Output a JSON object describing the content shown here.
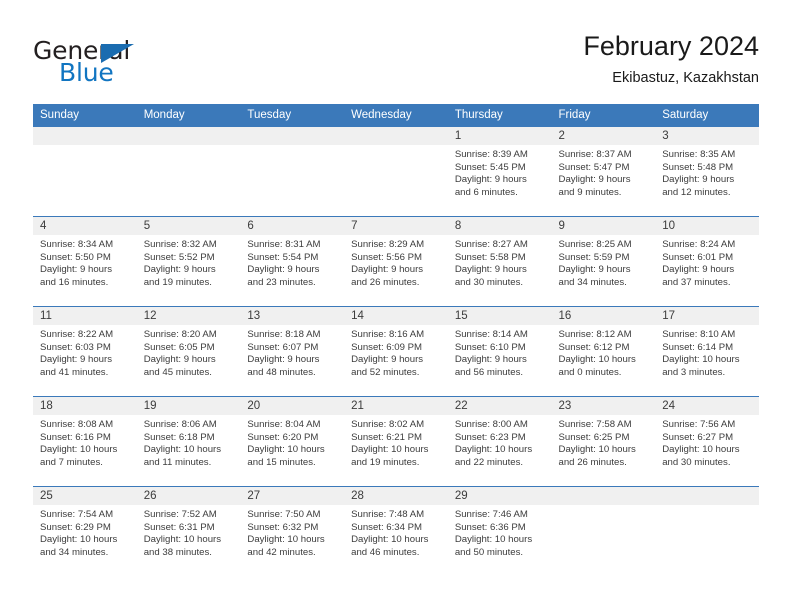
{
  "brand": {
    "name_top": "General",
    "name_bottom": "Blue",
    "flag_icon": "triangle-flag-icon",
    "accent_color": "#1175c1"
  },
  "header": {
    "title": "February 2024",
    "subtitle": "Ekibastuz, Kazakhstan"
  },
  "theme": {
    "header_blue": "#3b79ba",
    "daynum_band": "#f0f0f0",
    "text": "#3c3c3c"
  },
  "weekday_headers": [
    "Sunday",
    "Monday",
    "Tuesday",
    "Wednesday",
    "Thursday",
    "Friday",
    "Saturday"
  ],
  "weeks": [
    [
      {
        "day": "",
        "sunrise": "",
        "sunset": "",
        "daylight_line1": "",
        "daylight_line2": ""
      },
      {
        "day": "",
        "sunrise": "",
        "sunset": "",
        "daylight_line1": "",
        "daylight_line2": ""
      },
      {
        "day": "",
        "sunrise": "",
        "sunset": "",
        "daylight_line1": "",
        "daylight_line2": ""
      },
      {
        "day": "",
        "sunrise": "",
        "sunset": "",
        "daylight_line1": "",
        "daylight_line2": ""
      },
      {
        "day": "1",
        "sunrise": "Sunrise: 8:39 AM",
        "sunset": "Sunset: 5:45 PM",
        "daylight_line1": "Daylight: 9 hours",
        "daylight_line2": "and 6 minutes."
      },
      {
        "day": "2",
        "sunrise": "Sunrise: 8:37 AM",
        "sunset": "Sunset: 5:47 PM",
        "daylight_line1": "Daylight: 9 hours",
        "daylight_line2": "and 9 minutes."
      },
      {
        "day": "3",
        "sunrise": "Sunrise: 8:35 AM",
        "sunset": "Sunset: 5:48 PM",
        "daylight_line1": "Daylight: 9 hours",
        "daylight_line2": "and 12 minutes."
      }
    ],
    [
      {
        "day": "4",
        "sunrise": "Sunrise: 8:34 AM",
        "sunset": "Sunset: 5:50 PM",
        "daylight_line1": "Daylight: 9 hours",
        "daylight_line2": "and 16 minutes."
      },
      {
        "day": "5",
        "sunrise": "Sunrise: 8:32 AM",
        "sunset": "Sunset: 5:52 PM",
        "daylight_line1": "Daylight: 9 hours",
        "daylight_line2": "and 19 minutes."
      },
      {
        "day": "6",
        "sunrise": "Sunrise: 8:31 AM",
        "sunset": "Sunset: 5:54 PM",
        "daylight_line1": "Daylight: 9 hours",
        "daylight_line2": "and 23 minutes."
      },
      {
        "day": "7",
        "sunrise": "Sunrise: 8:29 AM",
        "sunset": "Sunset: 5:56 PM",
        "daylight_line1": "Daylight: 9 hours",
        "daylight_line2": "and 26 minutes."
      },
      {
        "day": "8",
        "sunrise": "Sunrise: 8:27 AM",
        "sunset": "Sunset: 5:58 PM",
        "daylight_line1": "Daylight: 9 hours",
        "daylight_line2": "and 30 minutes."
      },
      {
        "day": "9",
        "sunrise": "Sunrise: 8:25 AM",
        "sunset": "Sunset: 5:59 PM",
        "daylight_line1": "Daylight: 9 hours",
        "daylight_line2": "and 34 minutes."
      },
      {
        "day": "10",
        "sunrise": "Sunrise: 8:24 AM",
        "sunset": "Sunset: 6:01 PM",
        "daylight_line1": "Daylight: 9 hours",
        "daylight_line2": "and 37 minutes."
      }
    ],
    [
      {
        "day": "11",
        "sunrise": "Sunrise: 8:22 AM",
        "sunset": "Sunset: 6:03 PM",
        "daylight_line1": "Daylight: 9 hours",
        "daylight_line2": "and 41 minutes."
      },
      {
        "day": "12",
        "sunrise": "Sunrise: 8:20 AM",
        "sunset": "Sunset: 6:05 PM",
        "daylight_line1": "Daylight: 9 hours",
        "daylight_line2": "and 45 minutes."
      },
      {
        "day": "13",
        "sunrise": "Sunrise: 8:18 AM",
        "sunset": "Sunset: 6:07 PM",
        "daylight_line1": "Daylight: 9 hours",
        "daylight_line2": "and 48 minutes."
      },
      {
        "day": "14",
        "sunrise": "Sunrise: 8:16 AM",
        "sunset": "Sunset: 6:09 PM",
        "daylight_line1": "Daylight: 9 hours",
        "daylight_line2": "and 52 minutes."
      },
      {
        "day": "15",
        "sunrise": "Sunrise: 8:14 AM",
        "sunset": "Sunset: 6:10 PM",
        "daylight_line1": "Daylight: 9 hours",
        "daylight_line2": "and 56 minutes."
      },
      {
        "day": "16",
        "sunrise": "Sunrise: 8:12 AM",
        "sunset": "Sunset: 6:12 PM",
        "daylight_line1": "Daylight: 10 hours",
        "daylight_line2": "and 0 minutes."
      },
      {
        "day": "17",
        "sunrise": "Sunrise: 8:10 AM",
        "sunset": "Sunset: 6:14 PM",
        "daylight_line1": "Daylight: 10 hours",
        "daylight_line2": "and 3 minutes."
      }
    ],
    [
      {
        "day": "18",
        "sunrise": "Sunrise: 8:08 AM",
        "sunset": "Sunset: 6:16 PM",
        "daylight_line1": "Daylight: 10 hours",
        "daylight_line2": "and 7 minutes."
      },
      {
        "day": "19",
        "sunrise": "Sunrise: 8:06 AM",
        "sunset": "Sunset: 6:18 PM",
        "daylight_line1": "Daylight: 10 hours",
        "daylight_line2": "and 11 minutes."
      },
      {
        "day": "20",
        "sunrise": "Sunrise: 8:04 AM",
        "sunset": "Sunset: 6:20 PM",
        "daylight_line1": "Daylight: 10 hours",
        "daylight_line2": "and 15 minutes."
      },
      {
        "day": "21",
        "sunrise": "Sunrise: 8:02 AM",
        "sunset": "Sunset: 6:21 PM",
        "daylight_line1": "Daylight: 10 hours",
        "daylight_line2": "and 19 minutes."
      },
      {
        "day": "22",
        "sunrise": "Sunrise: 8:00 AM",
        "sunset": "Sunset: 6:23 PM",
        "daylight_line1": "Daylight: 10 hours",
        "daylight_line2": "and 22 minutes."
      },
      {
        "day": "23",
        "sunrise": "Sunrise: 7:58 AM",
        "sunset": "Sunset: 6:25 PM",
        "daylight_line1": "Daylight: 10 hours",
        "daylight_line2": "and 26 minutes."
      },
      {
        "day": "24",
        "sunrise": "Sunrise: 7:56 AM",
        "sunset": "Sunset: 6:27 PM",
        "daylight_line1": "Daylight: 10 hours",
        "daylight_line2": "and 30 minutes."
      }
    ],
    [
      {
        "day": "25",
        "sunrise": "Sunrise: 7:54 AM",
        "sunset": "Sunset: 6:29 PM",
        "daylight_line1": "Daylight: 10 hours",
        "daylight_line2": "and 34 minutes."
      },
      {
        "day": "26",
        "sunrise": "Sunrise: 7:52 AM",
        "sunset": "Sunset: 6:31 PM",
        "daylight_line1": "Daylight: 10 hours",
        "daylight_line2": "and 38 minutes."
      },
      {
        "day": "27",
        "sunrise": "Sunrise: 7:50 AM",
        "sunset": "Sunset: 6:32 PM",
        "daylight_line1": "Daylight: 10 hours",
        "daylight_line2": "and 42 minutes."
      },
      {
        "day": "28",
        "sunrise": "Sunrise: 7:48 AM",
        "sunset": "Sunset: 6:34 PM",
        "daylight_line1": "Daylight: 10 hours",
        "daylight_line2": "and 46 minutes."
      },
      {
        "day": "29",
        "sunrise": "Sunrise: 7:46 AM",
        "sunset": "Sunset: 6:36 PM",
        "daylight_line1": "Daylight: 10 hours",
        "daylight_line2": "and 50 minutes."
      },
      {
        "day": "",
        "sunrise": "",
        "sunset": "",
        "daylight_line1": "",
        "daylight_line2": ""
      },
      {
        "day": "",
        "sunrise": "",
        "sunset": "",
        "daylight_line1": "",
        "daylight_line2": ""
      }
    ]
  ]
}
